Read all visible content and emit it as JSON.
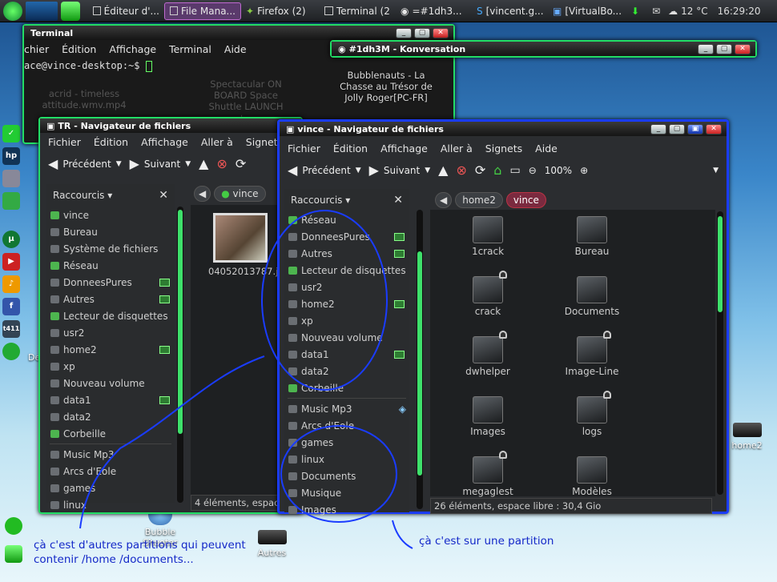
{
  "taskbar": {
    "tasks": [
      "Éditeur d'...",
      "File Mana...",
      "Firefox (2)",
      "Terminal (2",
      "=#1dh3...",
      "[vincent.g...",
      "[VirtualBo..."
    ],
    "weather": "12 °C",
    "clock": "16:29:20"
  },
  "terminal": {
    "title": "Terminal",
    "menu": [
      "chier",
      "Édition",
      "Affichage",
      "Terminal",
      "Aide"
    ],
    "prompt": "ace@vince-desktop:~$",
    "bg_text": [
      "acrid - timeless attitude.wmv.mp4",
      "Spectacular ON BOARD Space Shuttle LAUNCH +..."
    ]
  },
  "konversation": {
    "title": "#1dh3M - Konversation",
    "bg_text": "Bubblenauts - La Chasse au Trésor de Jolly Roger[PC-FR]"
  },
  "tr_window": {
    "title": "TR - Navigateur de fichiers",
    "menu": [
      "Fichier",
      "Édition",
      "Affichage",
      "Aller à",
      "Signets"
    ],
    "back": "Précédent",
    "forward": "Suivant",
    "side_header": "Raccourcis",
    "side_items": [
      "vince",
      "Bureau",
      "Système de fichiers",
      "Réseau",
      "DonneesPures",
      "Autres",
      "Lecteur de disquettes",
      "usr2",
      "home2",
      "xp",
      "Nouveau volume",
      "data1",
      "data2",
      "Corbeille",
      "Music Mp3",
      "Arcs d'Eole",
      "games",
      "linux"
    ],
    "path": [
      "vince"
    ],
    "file_name": "04052013787.j",
    "status": "4 éléments, espace"
  },
  "vince_window": {
    "title": "vince - Navigateur de fichiers",
    "menu": [
      "Fichier",
      "Édition",
      "Affichage",
      "Aller à",
      "Signets",
      "Aide"
    ],
    "back": "Précédent",
    "forward": "Suivant",
    "zoom": "100%",
    "side_header": "Raccourcis",
    "side_items": [
      "Réseau",
      "DonneesPures",
      "Autres",
      "Lecteur de disquettes",
      "usr2",
      "home2",
      "xp",
      "Nouveau volume",
      "data1",
      "data2",
      "Corbeille",
      "Music Mp3",
      "Arcs d'Eole",
      "games",
      "linux",
      "Documents",
      "Musique",
      "Images"
    ],
    "path": [
      "home2",
      "vince"
    ],
    "folders": [
      {
        "name": "1crack",
        "locked": false
      },
      {
        "name": "Bureau",
        "locked": false
      },
      {
        "name": "crack",
        "locked": true
      },
      {
        "name": "Documents",
        "locked": false
      },
      {
        "name": "dwhelper",
        "locked": true
      },
      {
        "name": "Image-Line",
        "locked": true
      },
      {
        "name": "Images",
        "locked": false
      },
      {
        "name": "logs",
        "locked": true
      },
      {
        "name": "megaglest",
        "locked": true
      },
      {
        "name": "Modèles",
        "locked": false
      }
    ],
    "status": "26 éléments, espace libre : 30,4 Gio"
  },
  "desktop": {
    "icons": [
      "Bubble Shooter",
      "Autres",
      "home2",
      "De j"
    ]
  },
  "annotations": {
    "left": "çà c'est d'autres partitions qui peuvent contenir /home /documents...",
    "right": "çà c'est sur une partition"
  },
  "colors": {
    "accent_green": "#3ee06b",
    "frame_blue": "#1a3cff",
    "annotation": "#1428c8"
  }
}
